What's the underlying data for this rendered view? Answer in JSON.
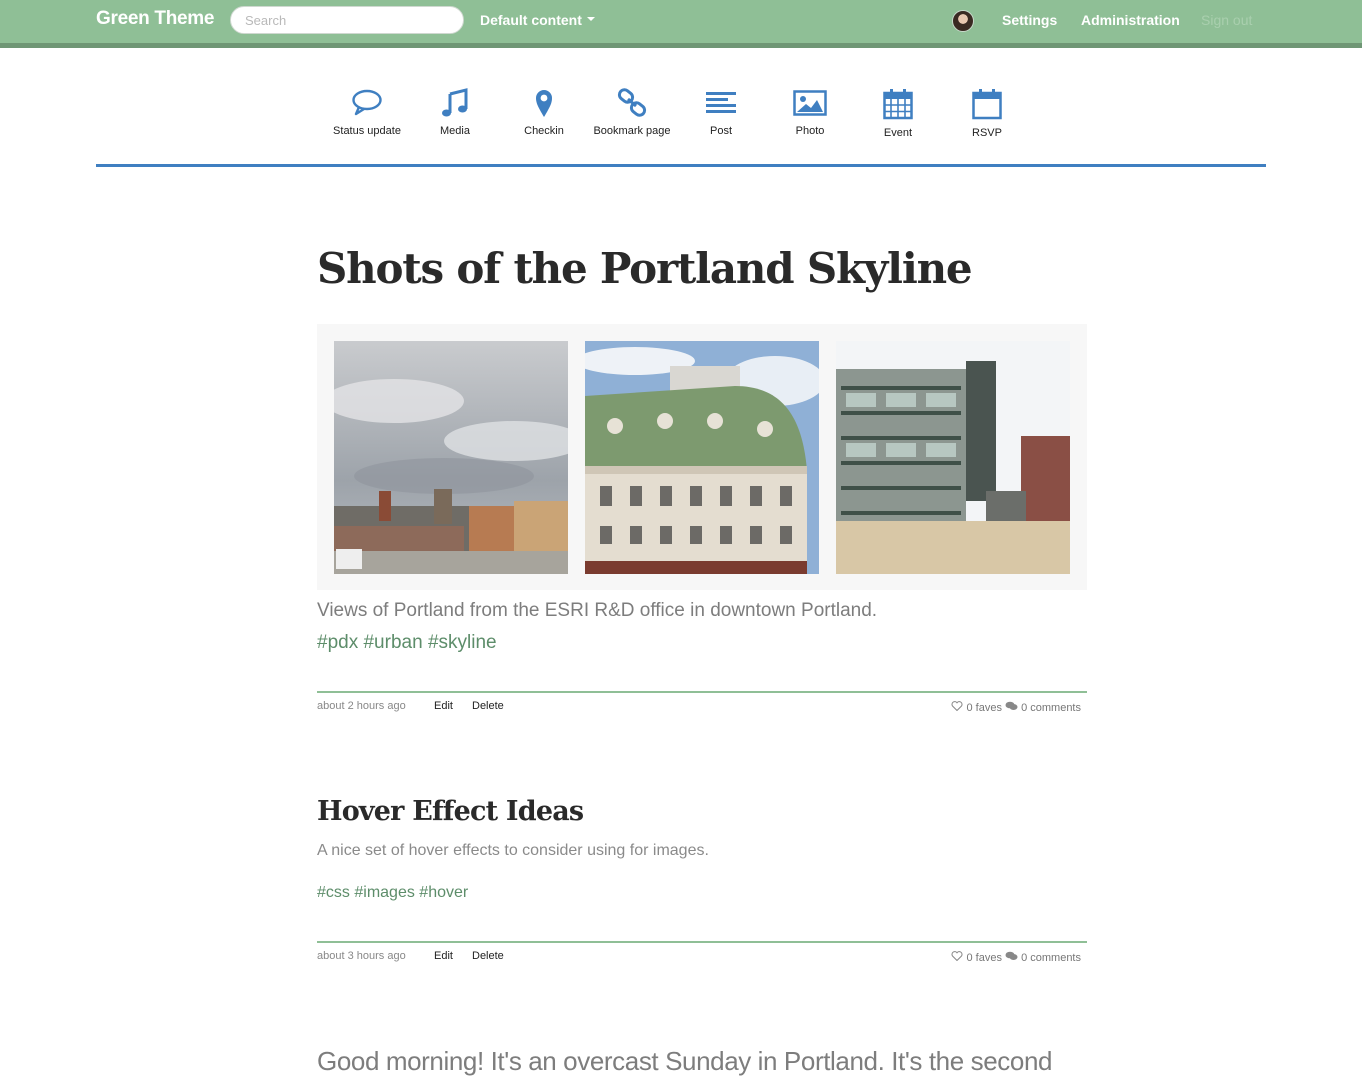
{
  "navbar": {
    "brand": "Green Theme",
    "search_placeholder": "Search",
    "dropdown_label": "Default content",
    "settings": "Settings",
    "administration": "Administration",
    "sign_out": "Sign out"
  },
  "toolbar": {
    "items": [
      {
        "label": "Status update",
        "icon": "speech-bubble-icon"
      },
      {
        "label": "Media",
        "icon": "music-note-icon"
      },
      {
        "label": "Checkin",
        "icon": "map-pin-icon"
      },
      {
        "label": "Bookmark page",
        "icon": "link-icon"
      },
      {
        "label": "Post",
        "icon": "text-lines-icon"
      },
      {
        "label": "Photo",
        "icon": "image-icon"
      },
      {
        "label": "Event",
        "icon": "calendar-icon"
      },
      {
        "label": "RSVP",
        "icon": "calendar-blank-icon"
      }
    ],
    "accent_color": "#3f7fc1"
  },
  "posts": [
    {
      "title": "Shots of the Portland Skyline",
      "body": "Views of Portland from the ESRI R&D office in downtown Portland.",
      "tags": [
        "#pdx",
        "#urban",
        "#skyline"
      ],
      "time": "about 2 hours ago",
      "edit": "Edit",
      "delete": "Delete",
      "faves": "0 faves",
      "comments": "0 comments"
    },
    {
      "title": "Hover Effect Ideas",
      "body": "A nice set of hover effects to consider using for images.",
      "tags": [
        "#css",
        "#images",
        "#hover"
      ],
      "time": "about 3 hours ago",
      "edit": "Edit",
      "delete": "Delete",
      "faves": "0 faves",
      "comments": "0 comments"
    },
    {
      "body": "Good morning! It's an overcast Sunday in Portland. It's the second"
    }
  ],
  "colors": {
    "nav_bg": "#8fbf96",
    "tag": "#5d8d6a",
    "rule": "#8fbf96"
  }
}
